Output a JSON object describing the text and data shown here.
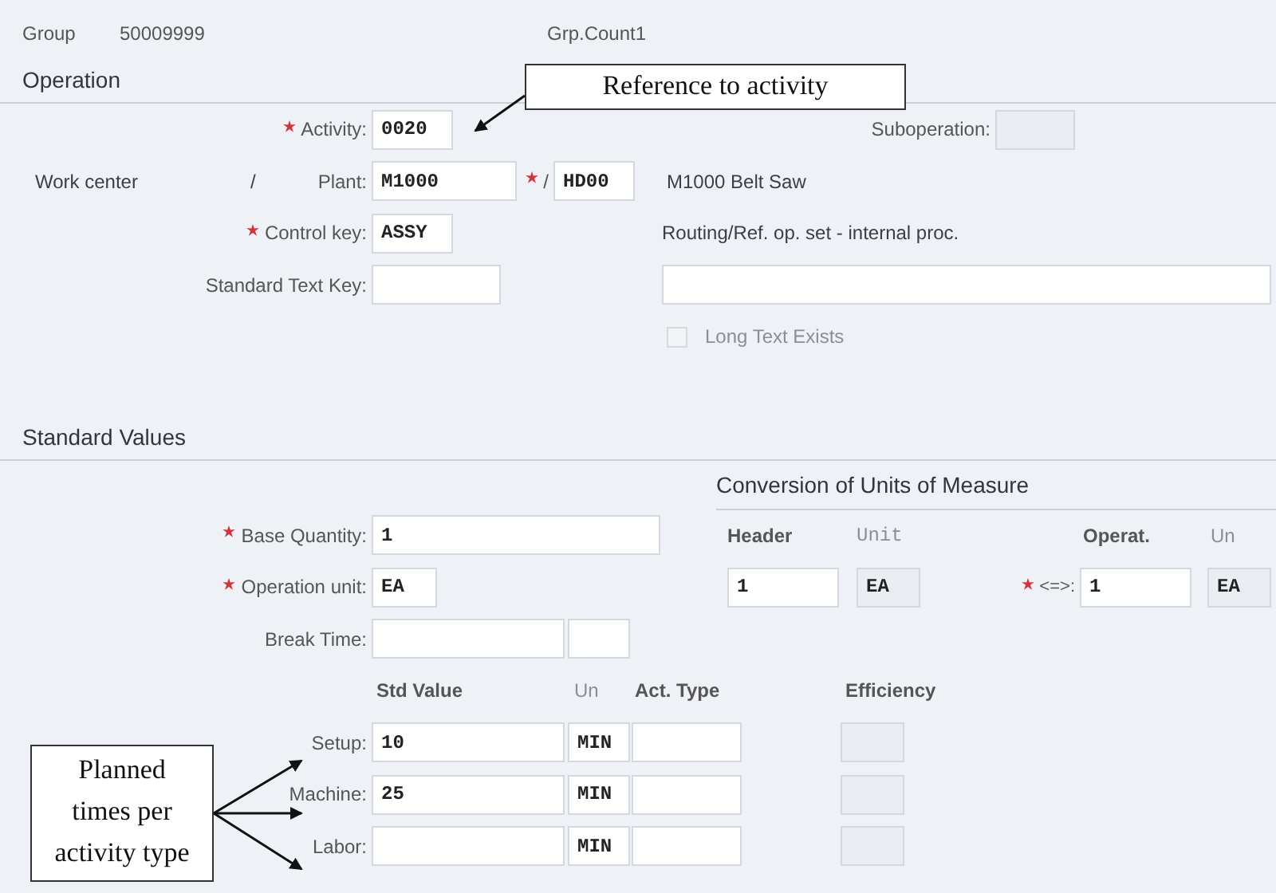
{
  "header": {
    "group_label": "Group",
    "group_value": "50009999",
    "count_label": "Grp.Count1"
  },
  "operation": {
    "title": "Operation",
    "activity": {
      "label": "Activity:",
      "value": "0020",
      "required": true
    },
    "suboperation": {
      "label": "Suboperation:",
      "disabled": true
    },
    "work_center_label": "Work center",
    "work_center_sep": "/",
    "plant": {
      "label": "Plant:",
      "value": "M1000"
    },
    "work_center": {
      "sep": "/",
      "value": "HD00",
      "required": true
    },
    "work_center_description": "M1000 Belt Saw",
    "control_key": {
      "label": "Control key:",
      "value": "ASSY",
      "required": true
    },
    "control_key_description": "Routing/Ref. op. set - internal proc.",
    "standard_text_key": {
      "label": "Standard Text Key:"
    },
    "long_text_exists": {
      "label": "Long Text Exists",
      "checked": false,
      "disabled": true
    }
  },
  "standard_values": {
    "title": "Standard Values",
    "base_quantity": {
      "label": "Base Quantity:",
      "value": "1",
      "required": true
    },
    "operation_unit": {
      "label": "Operation unit:",
      "value": "EA",
      "required": true
    },
    "break_time": {
      "label": "Break Time:"
    },
    "conversion": {
      "title": "Conversion of Units of Measure",
      "header_label": "Header",
      "unit_label": "Unit",
      "operat_label": "Operat.",
      "un_label": "Un",
      "header_value": "1",
      "header_unit": "EA",
      "sep": "<=>:",
      "required": true,
      "operat_value": "1",
      "operat_unit": "EA"
    },
    "columns": [
      "Std Value",
      "Un",
      "Act. Type",
      "Efficiency"
    ],
    "rows": [
      {
        "label": "Setup:",
        "value": "10",
        "unit": "MIN"
      },
      {
        "label": "Machine:",
        "value": "25",
        "unit": "MIN"
      },
      {
        "label": "Labor:",
        "unit": "MIN"
      }
    ]
  },
  "annotations": [
    {
      "text": "Reference to activity"
    },
    {
      "text": "Planned times per activity type"
    }
  ]
}
